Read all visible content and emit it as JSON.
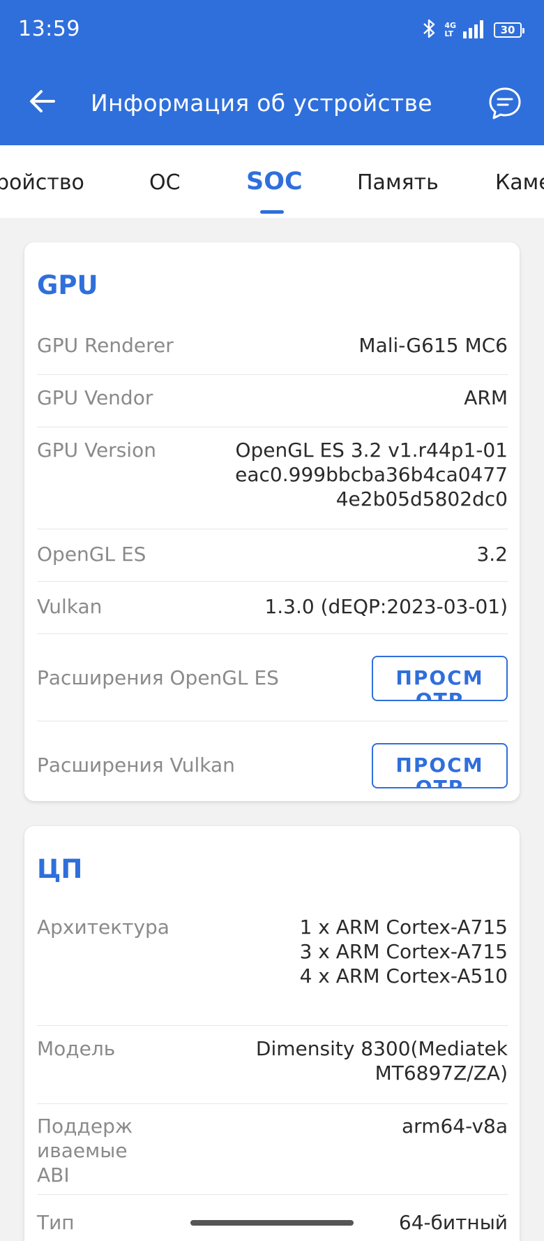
{
  "status_bar": {
    "time": "13:59",
    "network_label_top": "4G",
    "network_label_bottom": "LT",
    "battery": "30",
    "icons": [
      "bluetooth-icon",
      "signal-icon",
      "battery-icon"
    ]
  },
  "app_bar": {
    "title": "Информация об устройстве",
    "back_icon": "arrow-left-icon",
    "chat_icon": "chat-bubble-icon"
  },
  "tabs": [
    {
      "label": "ройство",
      "active": false
    },
    {
      "label": "ОС",
      "active": false
    },
    {
      "label": "SOC",
      "active": true
    },
    {
      "label": "Память",
      "active": false
    },
    {
      "label": "Каме",
      "active": false
    }
  ],
  "colors": {
    "accent": "#2f6fdb",
    "background": "#f2f2f2",
    "label_gray": "#8a8a8a"
  },
  "gpu": {
    "title": "GPU",
    "rows": [
      {
        "label": "GPU Renderer",
        "value": "Mali-G615 MC6"
      },
      {
        "label": "GPU Vendor",
        "value": "ARM"
      },
      {
        "label": "GPU Version",
        "value": "OpenGL ES 3.2 v1.r44p1-01\neac0.999bbcba36b4ca0477\n4e2b05d5802dc0"
      },
      {
        "label": "OpenGL ES",
        "value": "3.2"
      },
      {
        "label": "Vulkan",
        "value": "1.3.0 (dEQP:2023-03-01)"
      }
    ],
    "ext_opengl_label": "Расширения OpenGL ES",
    "ext_vulkan_label": "Расширения Vulkan",
    "view_button": "ПРОСМОТР"
  },
  "cpu": {
    "title": "ЦП",
    "rows": [
      {
        "label": "Архитектура",
        "value": "1 x ARM Cortex-A715\n3 x ARM Cortex-A715\n4 x ARM Cortex-A510"
      },
      {
        "label": "Модель",
        "value": "Dimensity 8300(Mediatek\nMT6897Z/ZA)"
      },
      {
        "label": "Поддерж\nиваемые\nABI",
        "value": "arm64-v8a"
      },
      {
        "label": "Тип",
        "value": "64-битный"
      }
    ]
  }
}
